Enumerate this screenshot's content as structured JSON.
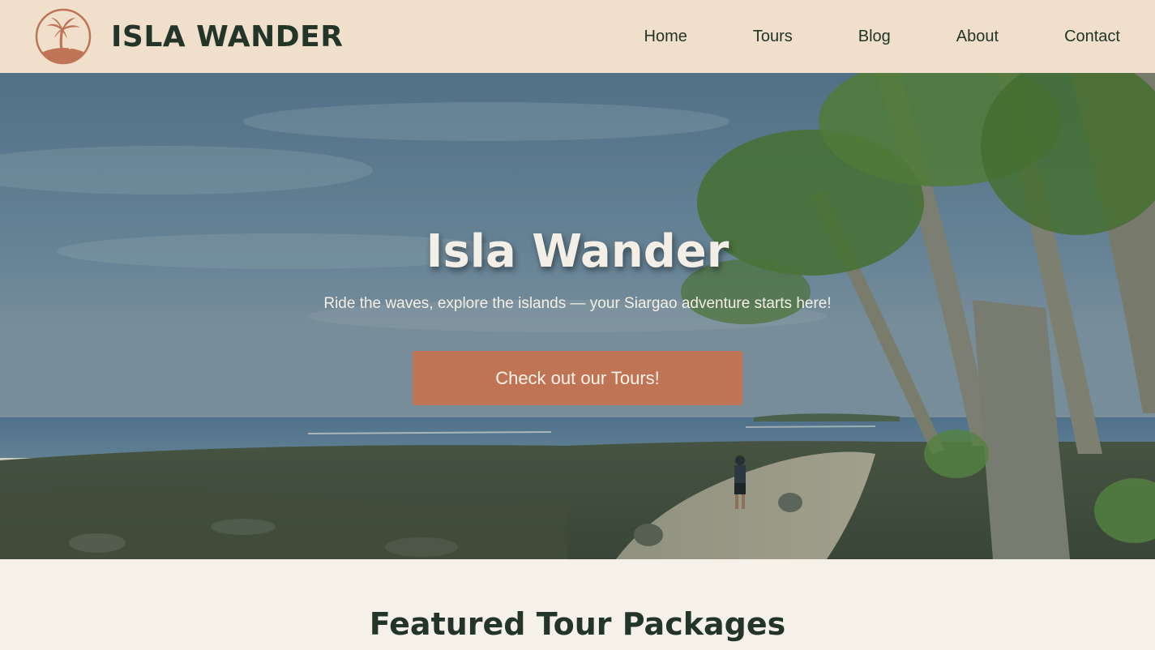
{
  "brand": {
    "name": "ISLA WANDER",
    "logo_icon": "palm-island-sunset-icon",
    "logo_color": "#bf7456"
  },
  "nav": {
    "items": [
      "Home",
      "Tours",
      "Blog",
      "About",
      "Contact"
    ]
  },
  "hero": {
    "title": "Isla Wander",
    "subtitle": "Ride the waves, explore the islands — your Siargao adventure starts here!",
    "cta_label": "Check out our Tours!",
    "cta_color": "#bf7456",
    "background_image": "beach-with-palm-trees-photo"
  },
  "featured": {
    "title": "Featured Tour Packages"
  },
  "colors": {
    "header_bg": "#f0dfcb",
    "text_dark": "#233529",
    "page_bg": "#f5f0e8"
  }
}
